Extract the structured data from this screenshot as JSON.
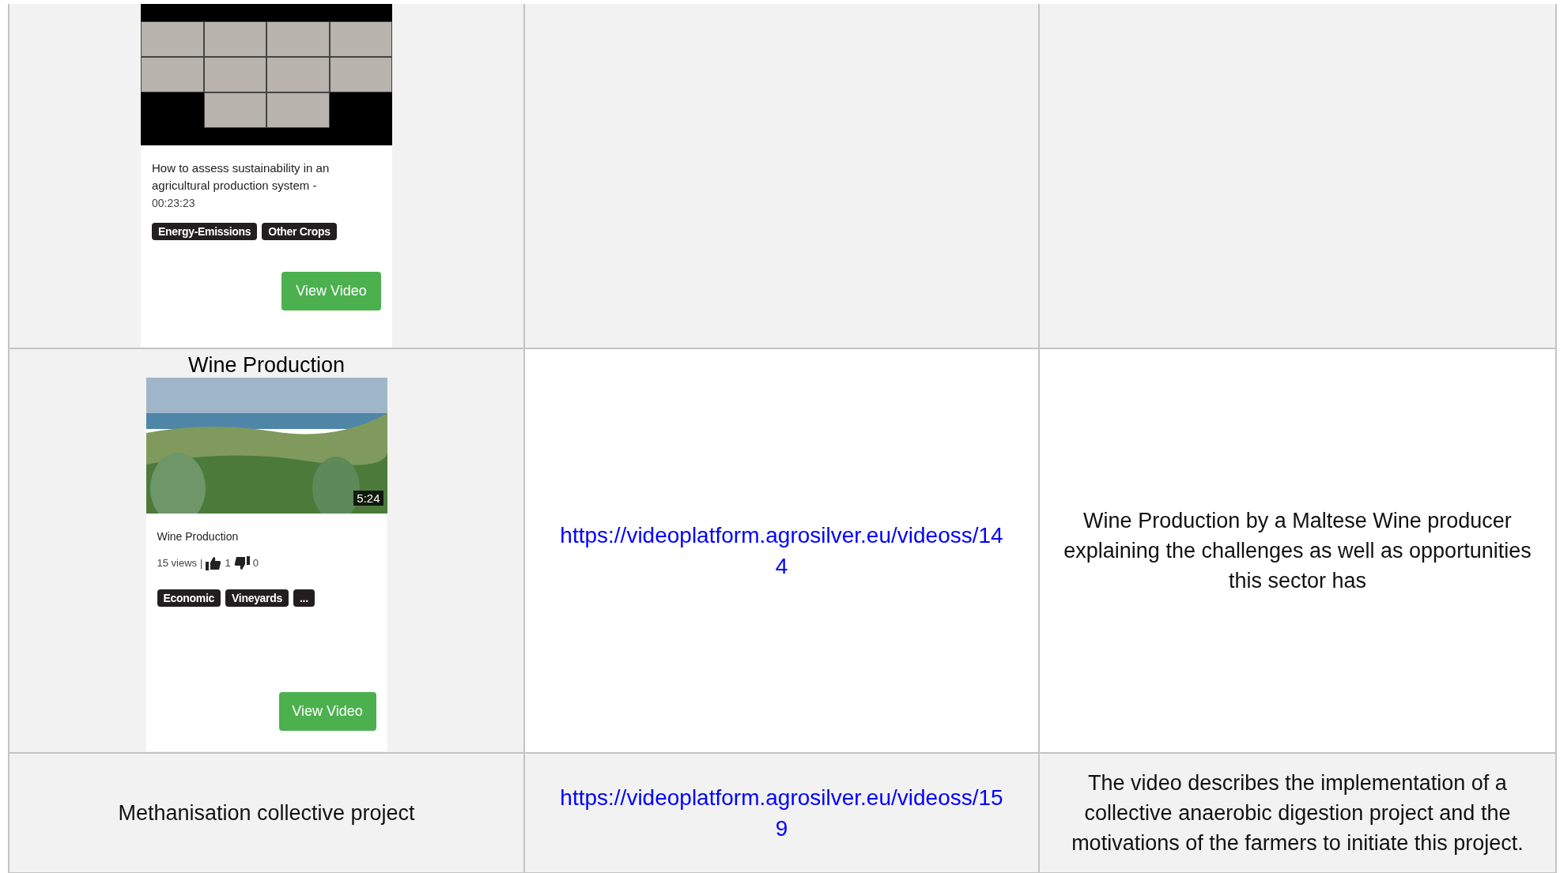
{
  "table": {
    "rows": [
      {
        "cells": [
          {
            "kind": "video",
            "shaded": true,
            "card": {
              "title": "How to assess sustainability in an agricultural production system -",
              "length": "00:23:23",
              "tags": [
                "Energy-Emissions",
                "Other Crops"
              ],
              "button": "View Video"
            }
          },
          {
            "kind": "empty",
            "shaded": true
          },
          {
            "kind": "empty",
            "shaded": true
          }
        ]
      },
      {
        "cells": [
          {
            "kind": "video",
            "shaded": true,
            "heading": "Wine Production",
            "card": {
              "badge": "5:24",
              "title": "Wine Production",
              "views": "15 views",
              "separator": "|",
              "likes": "1",
              "dislikes": "0",
              "tags": [
                "Economic",
                "Vineyards",
                "..."
              ],
              "button": "View Video"
            }
          },
          {
            "kind": "link",
            "shaded": false,
            "text": "https://videoplatform.agrosilver.eu/videoss/144"
          },
          {
            "kind": "text",
            "shaded": false,
            "text": "Wine Production by a Maltese Wine producer explaining the challenges as well as opportunities this sector has"
          }
        ]
      },
      {
        "cells": [
          {
            "kind": "text",
            "shaded": true,
            "text": "Methanisation collective project"
          },
          {
            "kind": "link",
            "shaded": true,
            "text": "https://videoplatform.agrosilver.eu/videoss/159"
          },
          {
            "kind": "text",
            "shaded": true,
            "text": "The video describes the implementation of a collective anaerobic digestion project and the motivations of the farmers to initiate this project."
          }
        ]
      }
    ]
  }
}
